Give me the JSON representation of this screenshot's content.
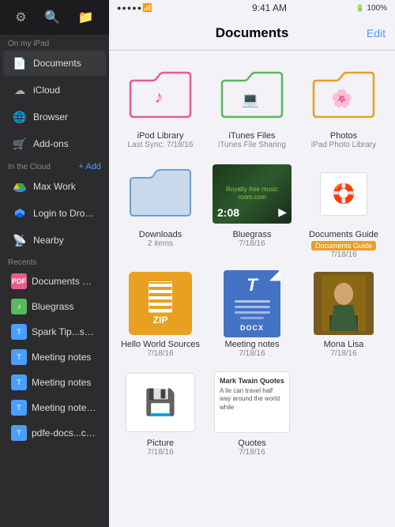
{
  "statusBar": {
    "time": "9:41 AM",
    "battery": "100%",
    "signal": "●●●●●"
  },
  "sidebar": {
    "title": "Documents",
    "editLabel": "Edit",
    "sections": [
      {
        "label": "On my iPad",
        "addBtn": null,
        "items": [
          {
            "id": "documents",
            "label": "Documents",
            "icon": "doc",
            "active": true
          },
          {
            "id": "icloud",
            "label": "iCloud",
            "icon": "cloud"
          },
          {
            "id": "browser",
            "label": "Browser",
            "icon": "browser"
          },
          {
            "id": "addons",
            "label": "Add-ons",
            "icon": "addons"
          }
        ]
      },
      {
        "label": "In the Cloud",
        "addBtn": "+ Add",
        "items": [
          {
            "id": "maxwork",
            "label": "Max Work",
            "icon": "drive"
          },
          {
            "id": "dropbox",
            "label": "Login to Dropbox",
            "icon": "dropbox"
          },
          {
            "id": "nearby",
            "label": "Nearby",
            "icon": "nearby"
          }
        ]
      },
      {
        "label": "Recents",
        "addBtn": null,
        "items": [
          {
            "id": "docguide",
            "label": "Documents Guide",
            "icon": "pdf",
            "color": "#e85d8a"
          },
          {
            "id": "bluegrass",
            "label": "Bluegrass",
            "icon": "music",
            "color": "#5cb85c"
          },
          {
            "id": "sparktip",
            "label": "Spark Tip...services-HD",
            "icon": "doc",
            "color": "#4a9eff"
          },
          {
            "id": "meetingnotes1",
            "label": "Meeting notes",
            "icon": "doc",
            "color": "#4a9eff"
          },
          {
            "id": "meetingnotes2",
            "label": "Meeting notes",
            "icon": "doc",
            "color": "#4a9eff"
          },
          {
            "id": "meetingnotes3",
            "label": "Meeting notes - iPhone",
            "icon": "doc",
            "color": "#4a9eff"
          },
          {
            "id": "pdfe",
            "label": "pdfe-docs...ck - iPhone",
            "icon": "doc",
            "color": "#4a9eff"
          }
        ]
      }
    ]
  },
  "main": {
    "navTitle": "Documents",
    "editLabel": "Edit",
    "items": [
      {
        "id": "ipod",
        "label": "iPod Library",
        "sublabel": "Last Sync: 7/18/16",
        "type": "folder-pink"
      },
      {
        "id": "itunes",
        "label": "iTunes Files",
        "sublabel": "iTunes File Sharing",
        "type": "folder-green"
      },
      {
        "id": "photos",
        "label": "Photos",
        "sublabel": "iPad Photo Library",
        "type": "folder-orange"
      },
      {
        "id": "downloads",
        "label": "Downloads",
        "sublabel": "2 items",
        "type": "folder-blue"
      },
      {
        "id": "bluegrass",
        "label": "Bluegrass",
        "sublabel": "7/18/16",
        "type": "video"
      },
      {
        "id": "docguide",
        "label": "Documents Guide",
        "sublabel": "7/18/16",
        "type": "guide",
        "badge": "Documents Guide"
      },
      {
        "id": "helloworld",
        "label": "Hello World Sources",
        "sublabel": "7/18/16",
        "type": "zip"
      },
      {
        "id": "meetingnotes",
        "label": "Meeting notes",
        "sublabel": "7/18/16",
        "type": "docx"
      },
      {
        "id": "monalisa",
        "label": "Mona Lisa",
        "sublabel": "7/18/16",
        "type": "mona"
      },
      {
        "id": "picture",
        "label": "Picture",
        "sublabel": "7/18/16",
        "type": "picture"
      },
      {
        "id": "quotes",
        "label": "Quotes",
        "sublabel": "7/18/16",
        "type": "quotes",
        "quotesTitle": "Mark Twain Quotes",
        "quotesBody": "A lie can travel half way around the world while"
      }
    ]
  }
}
